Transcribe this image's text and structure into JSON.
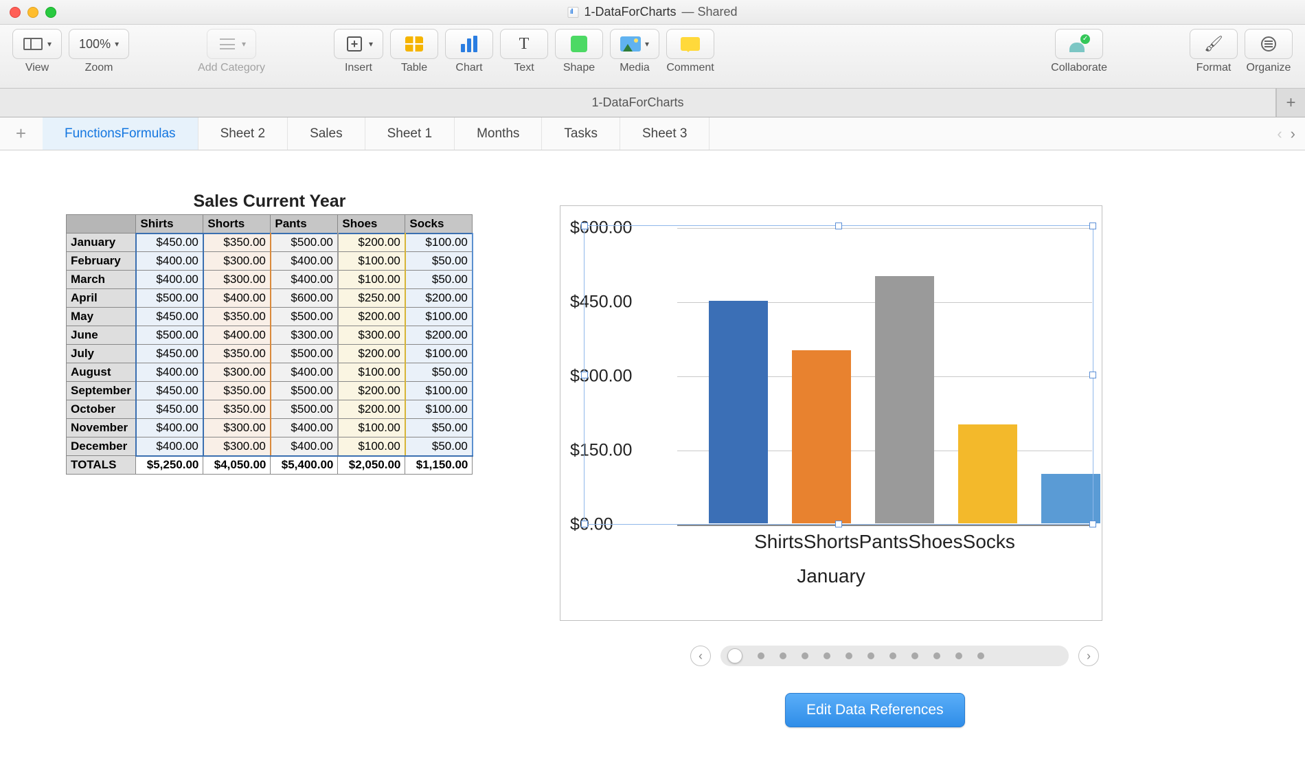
{
  "window": {
    "filename": "1-DataForCharts",
    "shared_suffix": "— Shared"
  },
  "toolbar": {
    "view": "View",
    "zoom": "Zoom",
    "zoom_value": "100%",
    "add_category": "Add Category",
    "insert": "Insert",
    "table": "Table",
    "chart": "Chart",
    "text": "Text",
    "shape": "Shape",
    "media": "Media",
    "comment": "Comment",
    "collaborate": "Collaborate",
    "format": "Format",
    "organize": "Organize"
  },
  "doc_tab": "1-DataForCharts",
  "sheet_tabs": [
    "FunctionsFormulas",
    "Sheet 2",
    "Sales",
    "Sheet 1",
    "Months",
    "Tasks",
    "Sheet 3"
  ],
  "active_sheet_index": 0,
  "table": {
    "title": "Sales Current Year",
    "columns": [
      "Shirts",
      "Shorts",
      "Pants",
      "Shoes",
      "Socks"
    ],
    "rows": [
      {
        "label": "January",
        "cells": [
          "$450.00",
          "$350.00",
          "$500.00",
          "$200.00",
          "$100.00"
        ]
      },
      {
        "label": "February",
        "cells": [
          "$400.00",
          "$300.00",
          "$400.00",
          "$100.00",
          "$50.00"
        ]
      },
      {
        "label": "March",
        "cells": [
          "$400.00",
          "$300.00",
          "$400.00",
          "$100.00",
          "$50.00"
        ]
      },
      {
        "label": "April",
        "cells": [
          "$500.00",
          "$400.00",
          "$600.00",
          "$250.00",
          "$200.00"
        ]
      },
      {
        "label": "May",
        "cells": [
          "$450.00",
          "$350.00",
          "$500.00",
          "$200.00",
          "$100.00"
        ]
      },
      {
        "label": "June",
        "cells": [
          "$500.00",
          "$400.00",
          "$300.00",
          "$300.00",
          "$200.00"
        ]
      },
      {
        "label": "July",
        "cells": [
          "$450.00",
          "$350.00",
          "$500.00",
          "$200.00",
          "$100.00"
        ]
      },
      {
        "label": "August",
        "cells": [
          "$400.00",
          "$300.00",
          "$400.00",
          "$100.00",
          "$50.00"
        ]
      },
      {
        "label": "September",
        "cells": [
          "$450.00",
          "$350.00",
          "$500.00",
          "$200.00",
          "$100.00"
        ]
      },
      {
        "label": "October",
        "cells": [
          "$450.00",
          "$350.00",
          "$500.00",
          "$200.00",
          "$100.00"
        ]
      },
      {
        "label": "November",
        "cells": [
          "$400.00",
          "$300.00",
          "$400.00",
          "$100.00",
          "$50.00"
        ]
      },
      {
        "label": "December",
        "cells": [
          "$400.00",
          "$300.00",
          "$400.00",
          "$100.00",
          "$50.00"
        ]
      }
    ],
    "totals": {
      "label": "TOTALS",
      "cells": [
        "$5,250.00",
        "$4,050.00",
        "$5,400.00",
        "$2,050.00",
        "$1,150.00"
      ]
    }
  },
  "chart_data": {
    "type": "bar",
    "title": "January",
    "categories": [
      "Shirts",
      "Shorts",
      "Pants",
      "Shoes",
      "Socks"
    ],
    "values": [
      450,
      350,
      500,
      200,
      100
    ],
    "ylim": [
      0,
      600
    ],
    "yticks": [
      "$600.00",
      "$450.00",
      "$300.00",
      "$150.00",
      "$0.00"
    ],
    "colors": [
      "#3b6fb6",
      "#e8822f",
      "#9a9a9a",
      "#f3b92b",
      "#5a9bd5"
    ]
  },
  "edit_btn": "Edit Data References"
}
